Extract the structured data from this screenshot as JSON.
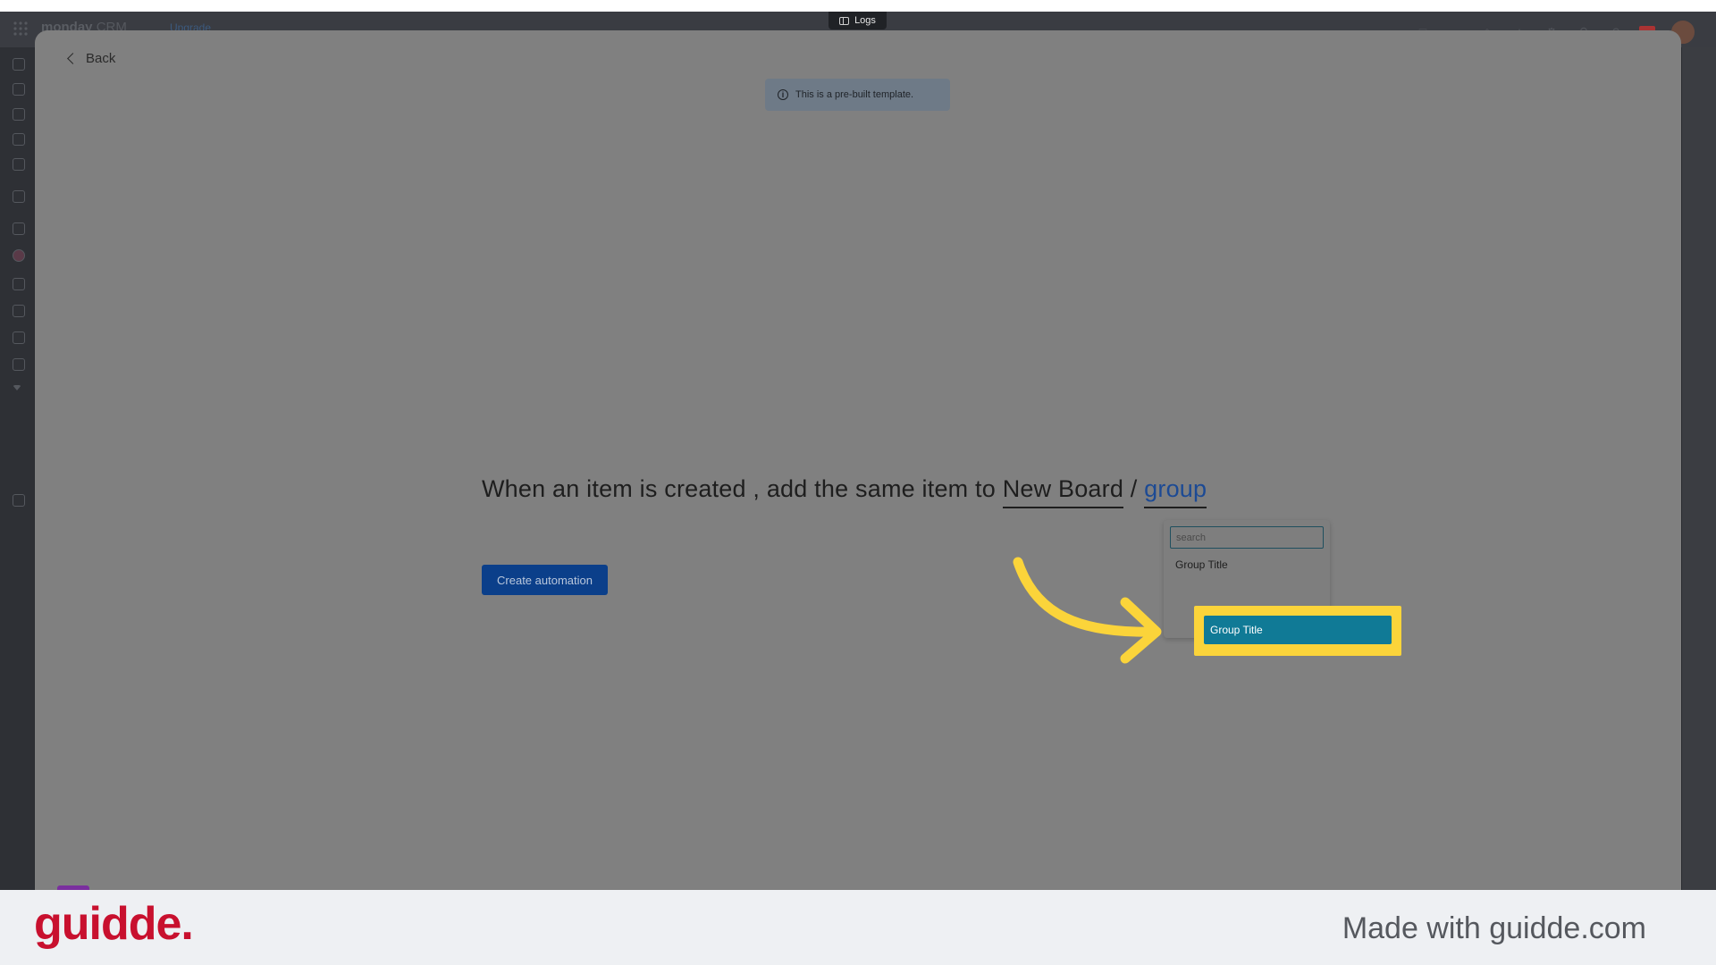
{
  "header": {
    "brand": "monday",
    "brand_sub": "CRM",
    "upgrade_label": "Upgrade",
    "logs_label": "Logs"
  },
  "modal": {
    "back_label": "Back",
    "info_text": "This is a pre-built template.",
    "sentence": {
      "part1": "When an item is created , add the same item to ",
      "board_token": "New Board",
      "separator": " / ",
      "group_token": "group"
    },
    "create_button_label": "Create automation"
  },
  "dropdown": {
    "search_placeholder": "search",
    "options": [
      "Group Title",
      "Group Title"
    ],
    "selected_index": 1
  },
  "footer": {
    "logo_text": "guidde.",
    "made_with": "Made with guidde.com"
  },
  "colors": {
    "highlight": "#fbd43a",
    "selected_option": "#107a96",
    "primary_button": "#0b3f8a",
    "logo_red": "#c8102e"
  }
}
